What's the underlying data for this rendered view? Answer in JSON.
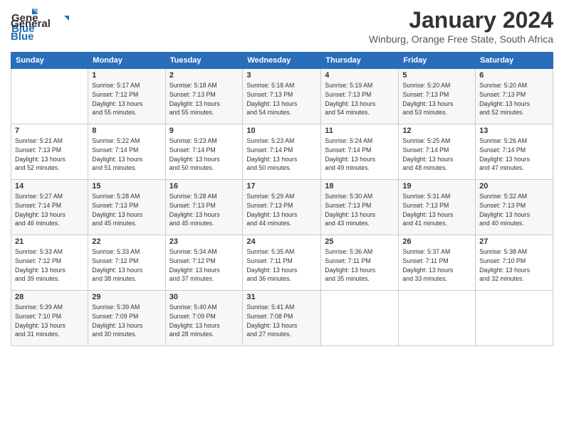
{
  "header": {
    "logo_general": "General",
    "logo_blue": "Blue",
    "month_title": "January 2024",
    "location": "Winburg, Orange Free State, South Africa"
  },
  "columns": [
    "Sunday",
    "Monday",
    "Tuesday",
    "Wednesday",
    "Thursday",
    "Friday",
    "Saturday"
  ],
  "weeks": [
    [
      {
        "num": "",
        "info": ""
      },
      {
        "num": "1",
        "info": "Sunrise: 5:17 AM\nSunset: 7:12 PM\nDaylight: 13 hours\nand 55 minutes."
      },
      {
        "num": "2",
        "info": "Sunrise: 5:18 AM\nSunset: 7:13 PM\nDaylight: 13 hours\nand 55 minutes."
      },
      {
        "num": "3",
        "info": "Sunrise: 5:18 AM\nSunset: 7:13 PM\nDaylight: 13 hours\nand 54 minutes."
      },
      {
        "num": "4",
        "info": "Sunrise: 5:19 AM\nSunset: 7:13 PM\nDaylight: 13 hours\nand 54 minutes."
      },
      {
        "num": "5",
        "info": "Sunrise: 5:20 AM\nSunset: 7:13 PM\nDaylight: 13 hours\nand 53 minutes."
      },
      {
        "num": "6",
        "info": "Sunrise: 5:20 AM\nSunset: 7:13 PM\nDaylight: 13 hours\nand 52 minutes."
      }
    ],
    [
      {
        "num": "7",
        "info": "Sunrise: 5:21 AM\nSunset: 7:13 PM\nDaylight: 13 hours\nand 52 minutes."
      },
      {
        "num": "8",
        "info": "Sunrise: 5:22 AM\nSunset: 7:14 PM\nDaylight: 13 hours\nand 51 minutes."
      },
      {
        "num": "9",
        "info": "Sunrise: 5:23 AM\nSunset: 7:14 PM\nDaylight: 13 hours\nand 50 minutes."
      },
      {
        "num": "10",
        "info": "Sunrise: 5:23 AM\nSunset: 7:14 PM\nDaylight: 13 hours\nand 50 minutes."
      },
      {
        "num": "11",
        "info": "Sunrise: 5:24 AM\nSunset: 7:14 PM\nDaylight: 13 hours\nand 49 minutes."
      },
      {
        "num": "12",
        "info": "Sunrise: 5:25 AM\nSunset: 7:14 PM\nDaylight: 13 hours\nand 48 minutes."
      },
      {
        "num": "13",
        "info": "Sunrise: 5:26 AM\nSunset: 7:14 PM\nDaylight: 13 hours\nand 47 minutes."
      }
    ],
    [
      {
        "num": "14",
        "info": "Sunrise: 5:27 AM\nSunset: 7:14 PM\nDaylight: 13 hours\nand 46 minutes."
      },
      {
        "num": "15",
        "info": "Sunrise: 5:28 AM\nSunset: 7:13 PM\nDaylight: 13 hours\nand 45 minutes."
      },
      {
        "num": "16",
        "info": "Sunrise: 5:28 AM\nSunset: 7:13 PM\nDaylight: 13 hours\nand 45 minutes."
      },
      {
        "num": "17",
        "info": "Sunrise: 5:29 AM\nSunset: 7:13 PM\nDaylight: 13 hours\nand 44 minutes."
      },
      {
        "num": "18",
        "info": "Sunrise: 5:30 AM\nSunset: 7:13 PM\nDaylight: 13 hours\nand 43 minutes."
      },
      {
        "num": "19",
        "info": "Sunrise: 5:31 AM\nSunset: 7:13 PM\nDaylight: 13 hours\nand 41 minutes."
      },
      {
        "num": "20",
        "info": "Sunrise: 5:32 AM\nSunset: 7:13 PM\nDaylight: 13 hours\nand 40 minutes."
      }
    ],
    [
      {
        "num": "21",
        "info": "Sunrise: 5:33 AM\nSunset: 7:12 PM\nDaylight: 13 hours\nand 39 minutes."
      },
      {
        "num": "22",
        "info": "Sunrise: 5:33 AM\nSunset: 7:12 PM\nDaylight: 13 hours\nand 38 minutes."
      },
      {
        "num": "23",
        "info": "Sunrise: 5:34 AM\nSunset: 7:12 PM\nDaylight: 13 hours\nand 37 minutes."
      },
      {
        "num": "24",
        "info": "Sunrise: 5:35 AM\nSunset: 7:11 PM\nDaylight: 13 hours\nand 36 minutes."
      },
      {
        "num": "25",
        "info": "Sunrise: 5:36 AM\nSunset: 7:11 PM\nDaylight: 13 hours\nand 35 minutes."
      },
      {
        "num": "26",
        "info": "Sunrise: 5:37 AM\nSunset: 7:11 PM\nDaylight: 13 hours\nand 33 minutes."
      },
      {
        "num": "27",
        "info": "Sunrise: 5:38 AM\nSunset: 7:10 PM\nDaylight: 13 hours\nand 32 minutes."
      }
    ],
    [
      {
        "num": "28",
        "info": "Sunrise: 5:39 AM\nSunset: 7:10 PM\nDaylight: 13 hours\nand 31 minutes."
      },
      {
        "num": "29",
        "info": "Sunrise: 5:39 AM\nSunset: 7:09 PM\nDaylight: 13 hours\nand 30 minutes."
      },
      {
        "num": "30",
        "info": "Sunrise: 5:40 AM\nSunset: 7:09 PM\nDaylight: 13 hours\nand 28 minutes."
      },
      {
        "num": "31",
        "info": "Sunrise: 5:41 AM\nSunset: 7:08 PM\nDaylight: 13 hours\nand 27 minutes."
      },
      {
        "num": "",
        "info": ""
      },
      {
        "num": "",
        "info": ""
      },
      {
        "num": "",
        "info": ""
      }
    ]
  ]
}
